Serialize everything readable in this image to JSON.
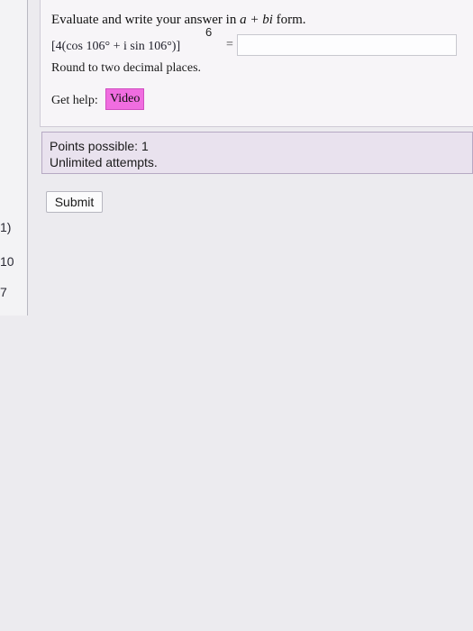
{
  "left_panel": {
    "items": [
      "1)",
      "10",
      "7"
    ]
  },
  "question": {
    "prompt_before": "Evaluate and write your answer in",
    "prompt_math": "a + bi",
    "prompt_after": "form.",
    "expression": "[4(cos 106° + i sin 106°)]",
    "exponent": "6",
    "equals": "=",
    "answer_value": "",
    "rounding_note": "Round to two decimal places.",
    "help_label": "Get help:",
    "video_label": "Video"
  },
  "info": {
    "points": "Points possible: 1",
    "attempts": "Unlimited attempts."
  },
  "submit_label": "Submit",
  "colors": {
    "video_button": "#f06de0",
    "info_box_bg": "#e9e2ee",
    "info_box_border": "#b6a9c3"
  }
}
